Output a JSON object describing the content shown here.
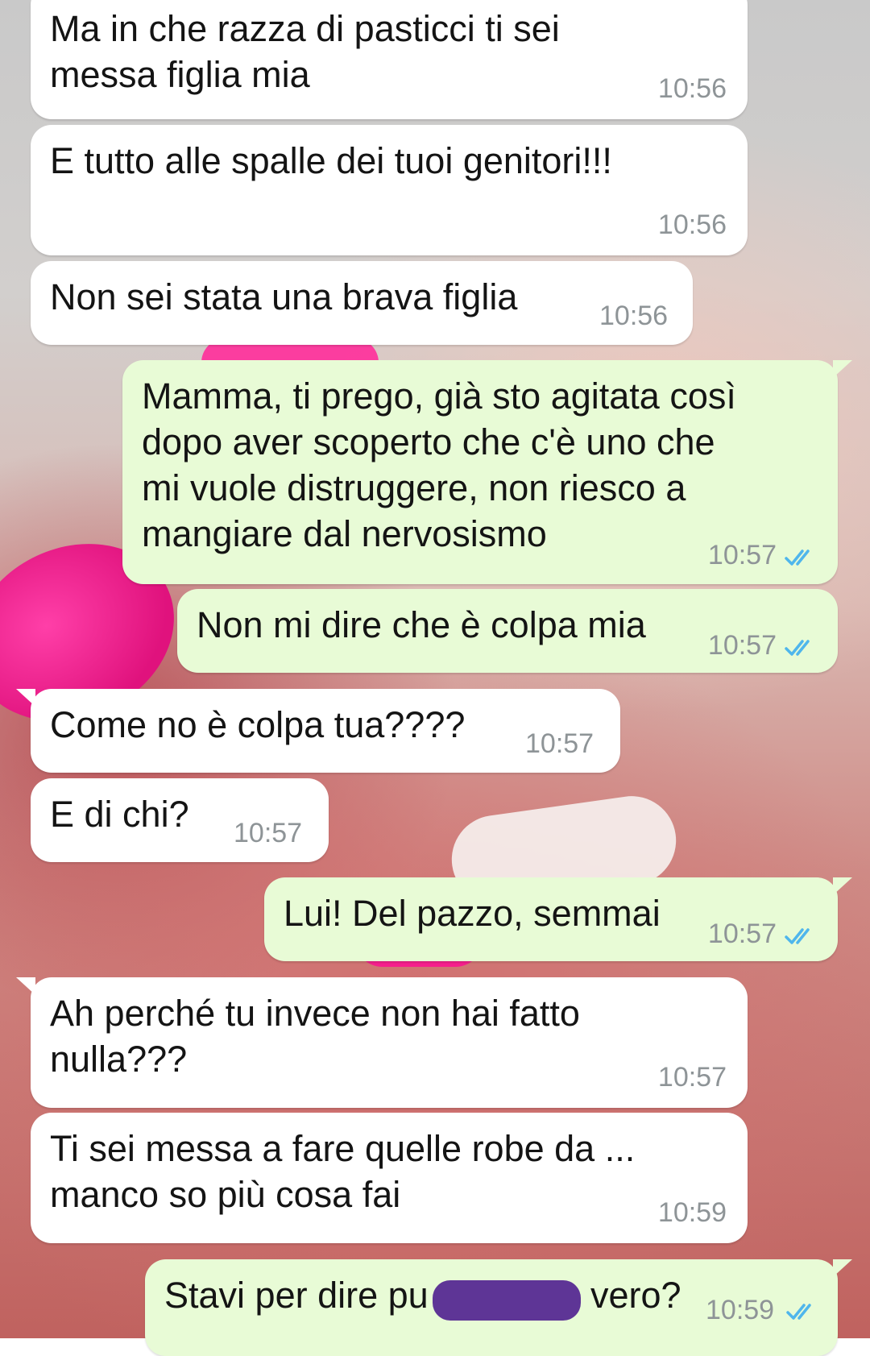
{
  "colors": {
    "incoming_bubble": "#ffffff",
    "outgoing_bubble": "#e8fbd6",
    "read_ticks": "#4fb6ec",
    "timestamp": "#8e9497",
    "redaction": "#5e3596"
  },
  "icons": {
    "read_receipt": "double-check-icon"
  },
  "messages": [
    {
      "direction": "incoming",
      "text": "Ma in che razza di pasticci ti sei\nmessa figlia mia",
      "time": "10:56"
    },
    {
      "direction": "incoming",
      "text": "E tutto alle spalle dei tuoi genitori!!!",
      "time": "10:56"
    },
    {
      "direction": "incoming",
      "text": "Non sei stata una brava figlia",
      "time": "10:56"
    },
    {
      "direction": "outgoing",
      "text": "Mamma, ti prego, già sto agitata così\ndopo aver scoperto che c'è uno che\nmi vuole distruggere, non riesco a\nmangiare dal nervosismo",
      "time": "10:57",
      "status": "read"
    },
    {
      "direction": "outgoing",
      "text": "Non mi dire che è colpa mia",
      "time": "10:57",
      "status": "read"
    },
    {
      "direction": "incoming",
      "text": "Come no è colpa tua????",
      "time": "10:57"
    },
    {
      "direction": "incoming",
      "text": "E di chi?",
      "time": "10:57"
    },
    {
      "direction": "outgoing",
      "text": "Lui! Del pazzo, semmai",
      "time": "10:57",
      "status": "read"
    },
    {
      "direction": "incoming",
      "text": "Ah perché tu invece non hai fatto\nnulla???",
      "time": "10:57"
    },
    {
      "direction": "incoming",
      "text": "Ti sei messa a fare quelle robe da ...\nmanco so più cosa fai",
      "time": "10:59"
    },
    {
      "direction": "outgoing",
      "text": "Stavi per dire pu",
      "text_after_redaction": "vero?",
      "time": "10:59",
      "status": "read",
      "redacted": true
    }
  ]
}
